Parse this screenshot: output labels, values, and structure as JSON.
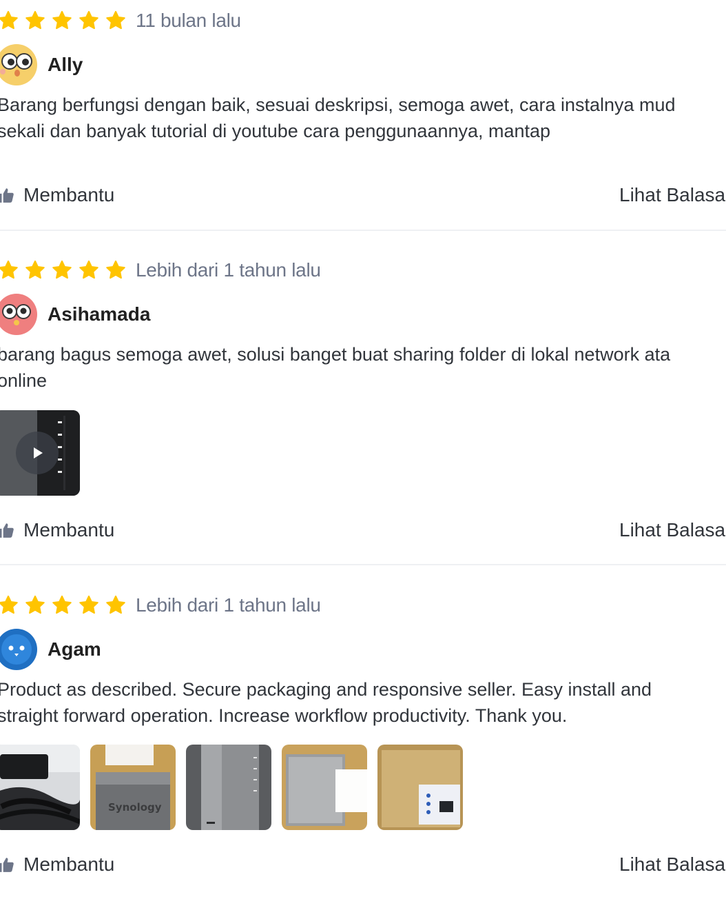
{
  "colors": {
    "star": "#ffc400",
    "muted_text": "#6d7588",
    "body_text": "#31353b",
    "divider": "#eef0f3"
  },
  "reviews": [
    {
      "rating": 5,
      "time": "11 bulan lalu",
      "username": "Ally",
      "avatar_icon": "owl-face-avatar-yellow",
      "text_lines": [
        "Barang berfungsi dengan baik, sesuai deskripsi, semoga awet, cara instalnya mud",
        "sekali dan banyak tutorial di youtube cara penggunaannya, mantap"
      ],
      "helpful_label": "Membantu",
      "reply_label": "Lihat Balasa"
    },
    {
      "rating": 5,
      "time": "Lebih dari 1 tahun lalu",
      "username": "Asihamada",
      "avatar_icon": "owl-face-avatar-red",
      "text_lines": [
        "barang bagus semoga awet, solusi banget buat sharing folder di lokal network ata",
        "online"
      ],
      "media": [
        "video-thumbnail-nas-device"
      ],
      "helpful_label": "Membantu",
      "reply_label": "Lihat Balasa"
    },
    {
      "rating": 5,
      "time": "Lebih dari 1 tahun lalu",
      "username": "Agam",
      "avatar_icon": "owl-face-avatar-blue",
      "text_lines": [
        "Product as described. Secure packaging and responsive seller. Easy install and",
        "straight forward operation. Increase workflow productivity. Thank you."
      ],
      "media": [
        "photo-cables",
        "photo-synology-box",
        "photo-nas-front",
        "photo-packaging-foam",
        "photo-gold-box"
      ],
      "photo_text": "Synology",
      "helpful_label": "Membantu",
      "reply_label": "Lihat Balasa"
    }
  ]
}
